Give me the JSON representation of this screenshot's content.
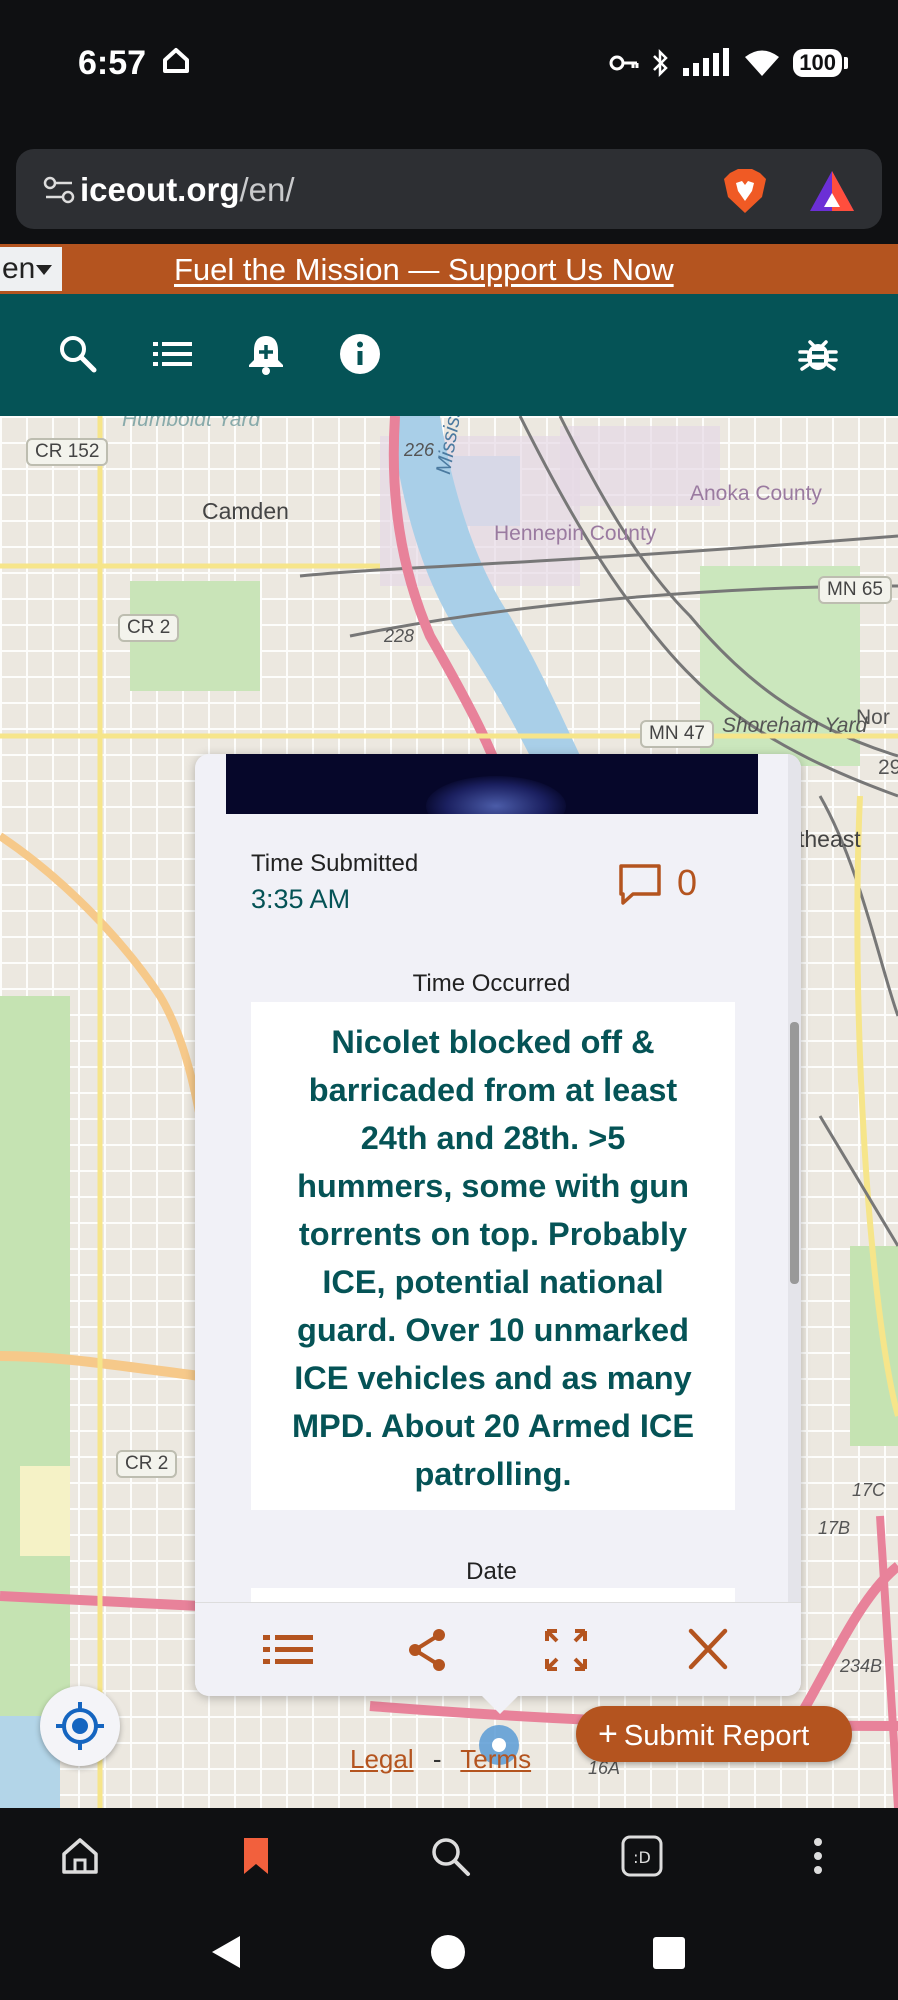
{
  "status_bar": {
    "time": "6:57",
    "battery": "100"
  },
  "browser": {
    "url_domain": "iceout.org",
    "url_path": "/en/"
  },
  "banner": {
    "language": "en",
    "link_text": "Fuel the Mission — Support Us Now"
  },
  "toolbar": {
    "icons": [
      "search-icon",
      "list-icon",
      "notification-add-icon",
      "info-icon",
      "bug-icon"
    ]
  },
  "map": {
    "labels": {
      "camden": "Camden",
      "anoka": "Anoka County",
      "hennepin": "Hennepin County",
      "mississippi": "Mississippi",
      "humboldt": "Humboldt Yard",
      "shoreham": "Shoreham Yard",
      "northeast": "theast",
      "nort": "Nor",
      "n29": "29"
    },
    "shields": {
      "cr152": "CR 152",
      "cr2_top": "CR 2",
      "cr2_bottom": "CR 2",
      "mn65": "MN 65",
      "mn47": "MN 47"
    },
    "routes": {
      "r226": "226",
      "r228": "228",
      "r17c": "17C",
      "r17b": "17B",
      "r234b": "234B",
      "r16a": "16A"
    },
    "accent_orange": "#b4541f",
    "accent_teal": "#055356"
  },
  "report": {
    "time_submitted_label": "Time Submitted",
    "time_submitted_value": "3:35 AM",
    "comment_count": "0",
    "time_occurred_label": "Time Occurred",
    "description": "Nicolet blocked off & barricaded from at least 24th and 28th. >5 hummers, some with gun torrents on top. Probably ICE, potential national guard. Over 10 unmarked ICE vehicles and as many MPD. About 20 Armed ICE patrolling.",
    "date_label": "Date"
  },
  "popup_actions": [
    "list-icon",
    "share-icon",
    "expand-icon",
    "close-icon"
  ],
  "footer": {
    "legal": "Legal",
    "separator": "-",
    "terms": "Terms",
    "submit_label": "Submit Report",
    "submit_plus": "+"
  }
}
